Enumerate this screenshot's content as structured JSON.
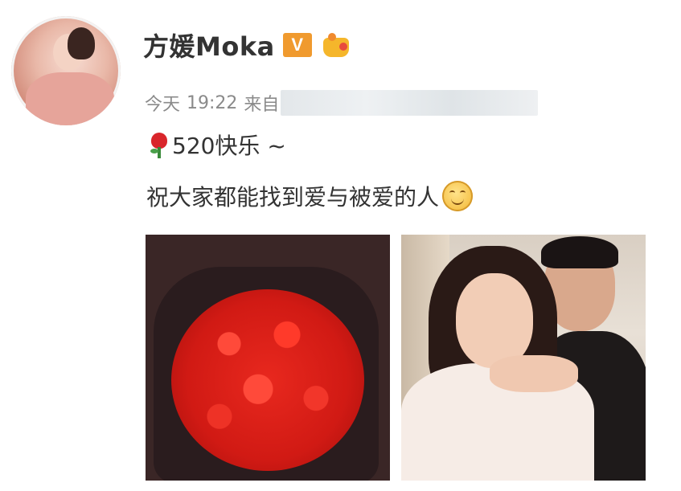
{
  "post": {
    "username": "方媛Moka",
    "verified_badge": "V",
    "time": "今天 19:22",
    "day_label": "今天",
    "time_label": "19:22",
    "source_label": "来自",
    "text_line1": "520快乐 ~",
    "text_line2": "祝大家都能找到爱与被爱的人"
  },
  "icons": {
    "verified": "verified-v-icon",
    "member": "member-crown-icon",
    "rose": "rose-emoji-icon",
    "smiley": "hug-smiley-emoji-icon"
  },
  "colors": {
    "username": "#333333",
    "meta": "#8a8a8a",
    "badge": "#f09a2e"
  }
}
